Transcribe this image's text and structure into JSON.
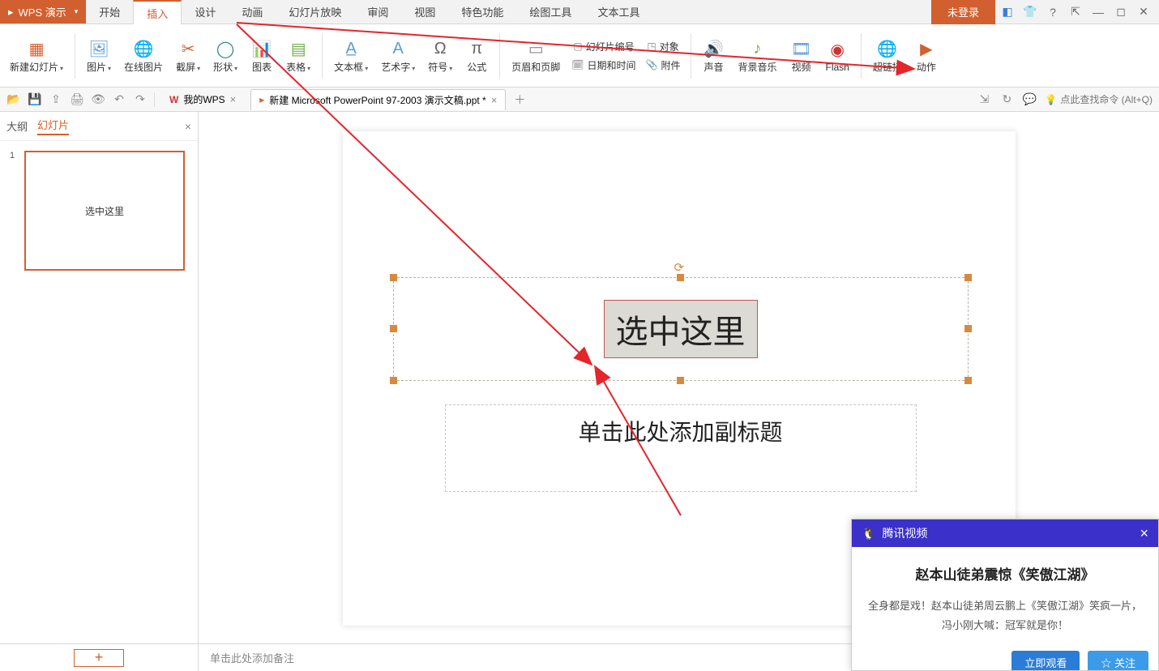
{
  "app": {
    "name": "WPS 演示",
    "login": "未登录"
  },
  "menu": {
    "tabs": [
      "开始",
      "插入",
      "设计",
      "动画",
      "幻灯片放映",
      "审阅",
      "视图",
      "特色功能",
      "绘图工具",
      "文本工具"
    ],
    "active_index": 1
  },
  "ribbon": {
    "new_slide": "新建幻灯片",
    "picture": "图片",
    "online_pic": "在线图片",
    "screenshot": "截屏",
    "shapes": "形状",
    "chart": "图表",
    "table": "表格",
    "textbox": "文本框",
    "wordart": "艺术字",
    "symbol": "符号",
    "equation": "公式",
    "header_footer": "页眉和页脚",
    "slide_number": "幻灯片编号",
    "object": "对象",
    "date_time": "日期和时间",
    "attachment": "附件",
    "audio": "声音",
    "bgm": "背景音乐",
    "video": "视频",
    "flash": "Flash",
    "hyperlink": "超链接",
    "action": "动作"
  },
  "qat": {
    "doc1": "我的WPS",
    "doc2": "新建 Microsoft PowerPoint 97-2003 演示文稿.ppt *",
    "search_hint": "点此查找命令 (Alt+Q)"
  },
  "sidebar": {
    "tab_outline": "大纲",
    "tab_slides": "幻灯片",
    "slide_num": "1",
    "thumb_text": "选中这里"
  },
  "slide": {
    "title": "选中这里",
    "subtitle": "单击此处添加副标题"
  },
  "notes": {
    "placeholder": "单击此处添加备注"
  },
  "popup": {
    "brand": "腾讯视频",
    "title": "赵本山徒弟震惊《笑傲江湖》",
    "desc": "全身都是戏！赵本山徒弟周云鹏上《笑傲江湖》笑疯一片，冯小刚大喊：冠军就是你！",
    "btn_watch": "立即观看",
    "btn_follow": "☆ 关注"
  }
}
